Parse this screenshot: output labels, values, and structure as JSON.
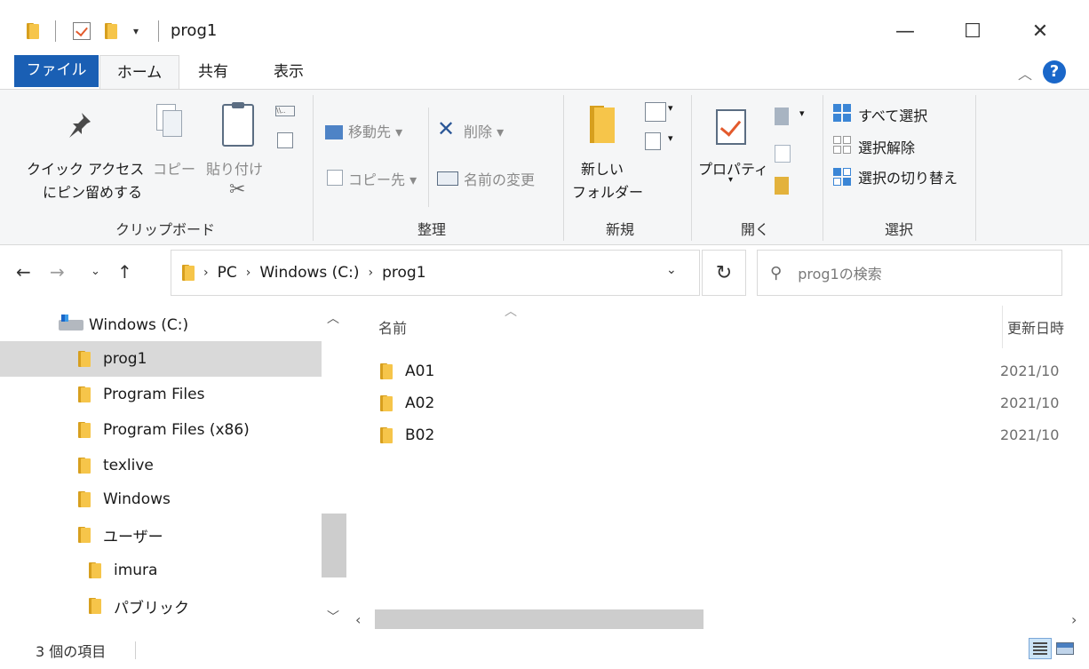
{
  "window": {
    "title": "prog1",
    "minimize_glyph": "—",
    "maximize_glyph": "☐",
    "close_glyph": "✕"
  },
  "ribbon_tabs": [
    {
      "label": "ファイル"
    },
    {
      "label": "ホーム"
    },
    {
      "label": "共有"
    },
    {
      "label": "表示"
    }
  ],
  "ribbon": {
    "clipboard": {
      "pin_label_line1": "クイック アクセス",
      "pin_label_line2": "にピン留めする",
      "copy_label": "コピー",
      "paste_label": "貼り付け",
      "group_label": "クリップボード"
    },
    "organize": {
      "move_to": "移動先 ▾",
      "copy_to": "コピー先 ▾",
      "delete": "削除 ▾",
      "rename": "名前の変更",
      "group_label": "整理"
    },
    "new": {
      "new_folder_line1": "新しい",
      "new_folder_line2": "フォルダー",
      "group_label": "新規"
    },
    "open": {
      "properties": "プロパティ",
      "group_label": "開く"
    },
    "select": {
      "select_all": "すべて選択",
      "select_none": "選択解除",
      "invert_selection": "選択の切り替え",
      "group_label": "選択"
    }
  },
  "address_bar": {
    "crumbs": [
      "PC",
      "Windows (C:)",
      "prog1"
    ],
    "search_placeholder": "prog1の検索"
  },
  "nav_pane": {
    "items": [
      {
        "label": "Windows (C:)",
        "type": "drive"
      },
      {
        "label": "prog1",
        "type": "folder",
        "selected": true
      },
      {
        "label": "Program Files",
        "type": "folder"
      },
      {
        "label": "Program Files (x86)",
        "type": "folder"
      },
      {
        "label": "texlive",
        "type": "folder"
      },
      {
        "label": "Windows",
        "type": "folder"
      },
      {
        "label": "ユーザー",
        "type": "folder"
      },
      {
        "label": "imura",
        "type": "folder"
      },
      {
        "label": "パブリック",
        "type": "folder"
      }
    ]
  },
  "content": {
    "columns": {
      "name": "名前",
      "modified": "更新日時"
    },
    "files": [
      {
        "name": "A01",
        "modified": "2021/10"
      },
      {
        "name": "A02",
        "modified": "2021/10"
      },
      {
        "name": "B02",
        "modified": "2021/10"
      }
    ]
  },
  "status_bar": {
    "item_count": "3 個の項目"
  },
  "colors": {
    "accent": "#1a5fb4",
    "folder": "#f6c54a",
    "selection": "#d9d9d9"
  }
}
